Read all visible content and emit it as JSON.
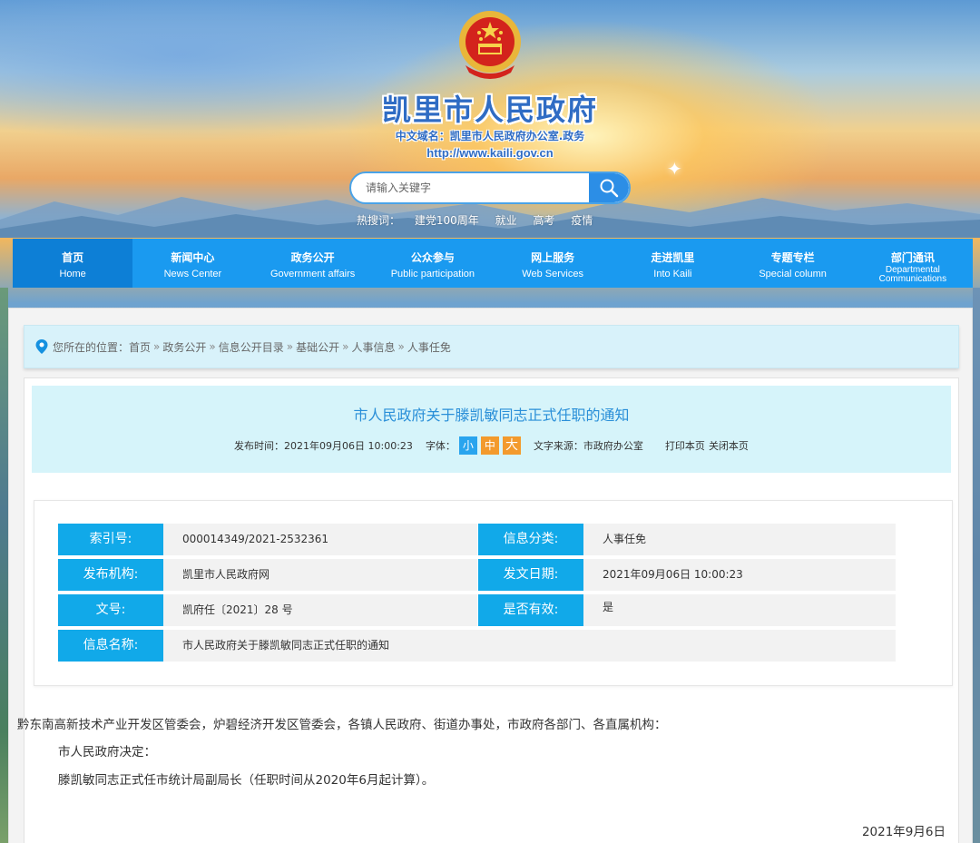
{
  "header": {
    "site_title": "凯里市人民政府",
    "domain_cn": "中文域名：凯里市人民政府办公室.政务",
    "domain_url": "http://www.kaili.gov.cn",
    "search_placeholder": "请输入关键字",
    "hotwords_label": "热搜词：",
    "hotwords": [
      "建党100周年",
      "就业",
      "高考",
      "疫情"
    ]
  },
  "nav": [
    {
      "cn": "首页",
      "en": "Home"
    },
    {
      "cn": "新闻中心",
      "en": "News Center"
    },
    {
      "cn": "政务公开",
      "en": "Government affairs"
    },
    {
      "cn": "公众参与",
      "en": "Public participation"
    },
    {
      "cn": "网上服务",
      "en": "Web Services"
    },
    {
      "cn": "走进凯里",
      "en": "Into Kaili"
    },
    {
      "cn": "专题专栏",
      "en": "Special column"
    },
    {
      "cn": "部门通讯",
      "en": "Departmental Communications"
    }
  ],
  "breadcrumb": {
    "prefix": "您所在的位置：",
    "items": [
      "首页",
      "政务公开",
      "信息公开目录",
      "基础公开",
      "人事信息",
      "人事任免"
    ],
    "separator": "»"
  },
  "article": {
    "title": "市人民政府关于滕凯敏同志正式任职的通知",
    "publish_time_label": "发布时间：2021年09月06日 10:00:23",
    "font_label": "字体：",
    "font_small": "小",
    "font_medium": "中",
    "font_large": "大",
    "source_label": "文字来源：市政府办公室",
    "print_label": "打印本页",
    "close_label": "关闭本页"
  },
  "info": {
    "index_label": "索引号:",
    "index_value": "000014349/2021-2532361",
    "category_label": "信息分类:",
    "category_value": "人事任免",
    "publisher_label": "发布机构:",
    "publisher_value": "凯里市人民政府网",
    "date_label": "发文日期:",
    "date_value": "2021年09月06日 10:00:23",
    "docno_label": "文号:",
    "docno_value": "凯府任〔2021〕28 号",
    "valid_label": "是否有效:",
    "valid_value": "是",
    "name_label": "信息名称:",
    "name_value": "市人民政府关于滕凯敏同志正式任职的通知"
  },
  "body": {
    "recipients": "黔东南高新技术产业开发区管委会，炉碧经济开发区管委会，各镇人民政府、街道办事处，市政府各部门、各直属机构：",
    "decision": "市人民政府决定：",
    "appointment": "滕凯敏同志正式任市统计局副局长（任职时间从2020年6月起计算）。",
    "date": "2021年9月6日"
  },
  "colors": {
    "nav_blue": "#1a9af0",
    "nav_active": "#0d7fd6",
    "label_blue": "#11a9e9",
    "title_blue": "#2a8fd8",
    "orange": "#f39a2d"
  }
}
